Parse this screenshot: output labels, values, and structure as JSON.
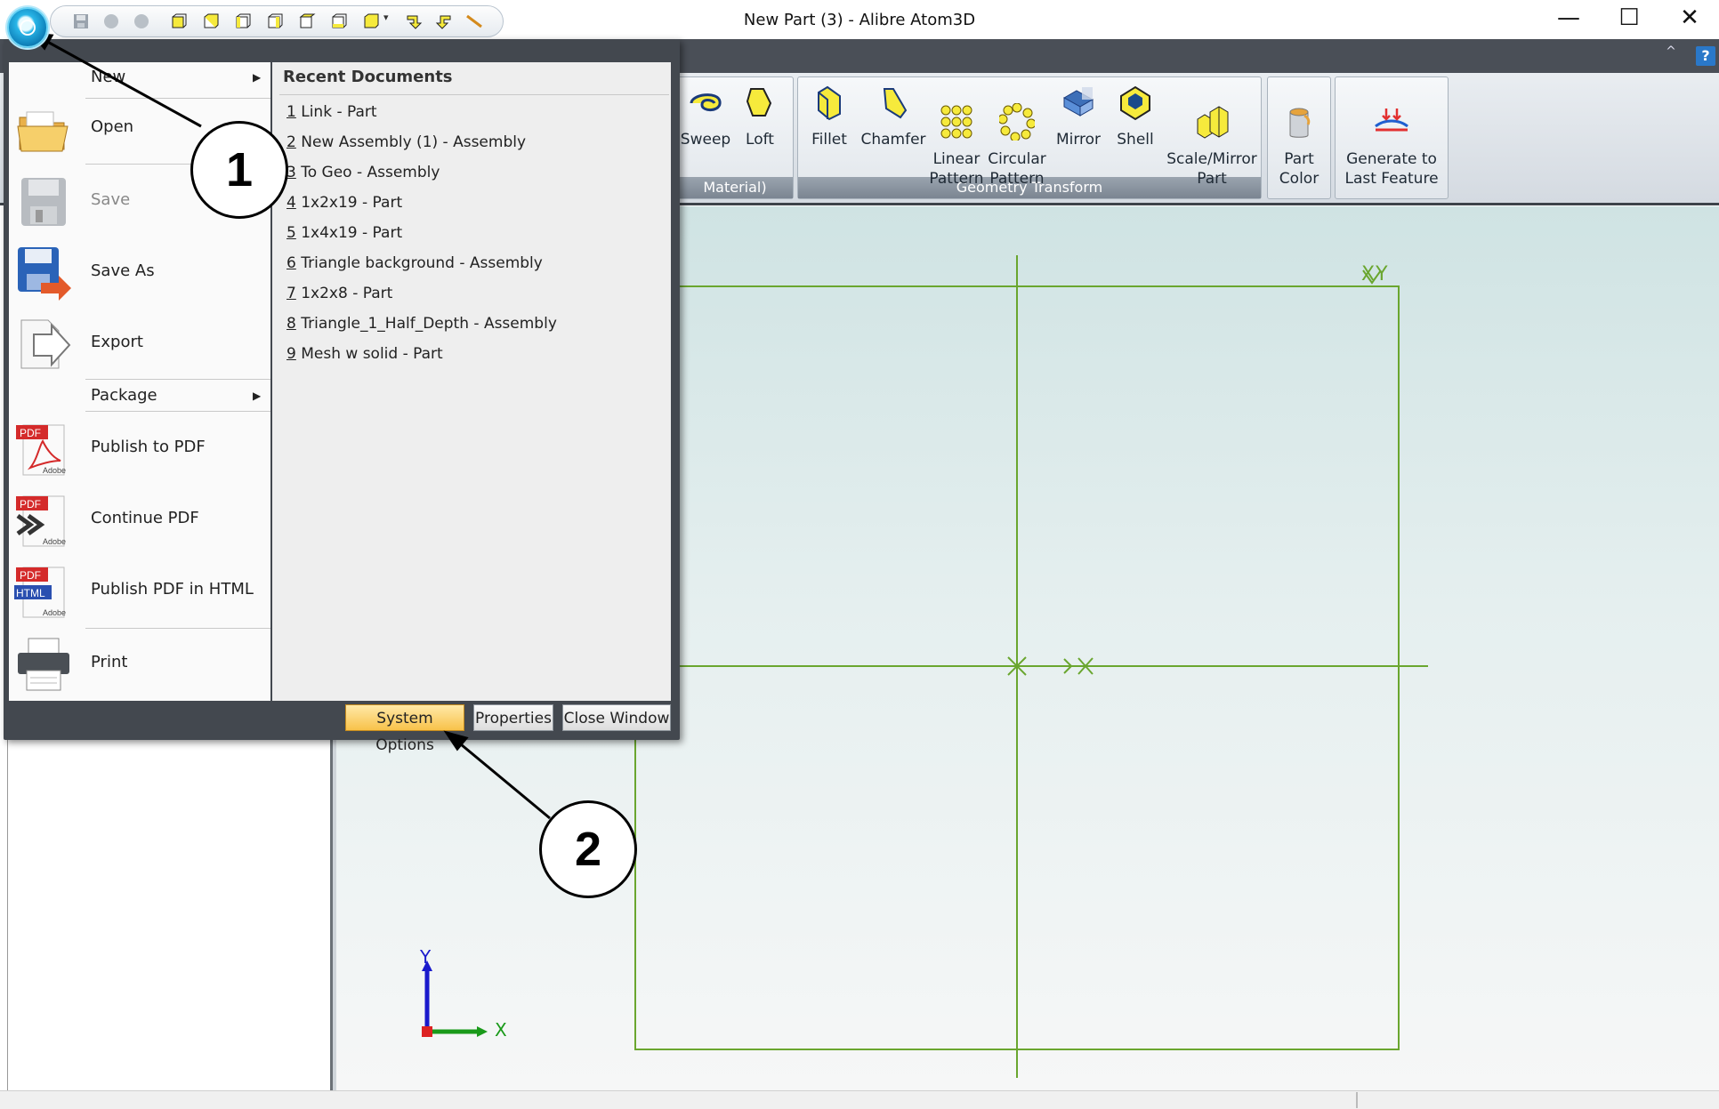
{
  "window": {
    "title": "New Part (3) - Alibre Atom3D",
    "minimize_glyph": "—",
    "maximize_glyph": "☐",
    "close_glyph": "✕"
  },
  "ribbon": {
    "help_label": "?",
    "collapse_glyph": "^",
    "groups": [
      {
        "label": "Material)",
        "buttons": [
          {
            "label": "Sweep"
          },
          {
            "label": "Loft"
          }
        ]
      },
      {
        "label": "Geometry Transform",
        "buttons": [
          {
            "label": "Fillet"
          },
          {
            "label": "Chamfer"
          },
          {
            "label": "Linear\nPattern"
          },
          {
            "label": "Circular\nPattern"
          },
          {
            "label": "Mirror"
          },
          {
            "label": "Shell"
          },
          {
            "label": "Scale/Mirror\nPart"
          }
        ]
      },
      {
        "label": "",
        "buttons": [
          {
            "label": "Part\nColor"
          }
        ]
      },
      {
        "label": "",
        "buttons": [
          {
            "label": "Generate to\nLast Feature"
          }
        ]
      }
    ]
  },
  "app_menu": {
    "items": [
      {
        "label": "New",
        "submenu": true
      },
      {
        "label": "Open"
      },
      {
        "label": "Save",
        "disabled": true
      },
      {
        "label": "Save As"
      },
      {
        "label": "Export"
      },
      {
        "label": "Package",
        "submenu": true
      },
      {
        "label": "Publish to PDF"
      },
      {
        "label": "Continue PDF"
      },
      {
        "label": "Publish PDF in HTML"
      },
      {
        "label": "Print"
      }
    ],
    "recent_heading": "Recent Documents",
    "recent": [
      {
        "num": "1",
        "name": " Link - Part"
      },
      {
        "num": "2",
        "name": " New Assembly (1) - Assembly"
      },
      {
        "num": "3",
        "name": " To Geo - Assembly"
      },
      {
        "num": "4",
        "name": " 1x2x19 - Part"
      },
      {
        "num": "5",
        "name": " 1x4x19 - Part"
      },
      {
        "num": "6",
        "name": " Triangle background - Assembly"
      },
      {
        "num": "7",
        "name": " 1x2x8 - Part"
      },
      {
        "num": "8",
        "name": " Triangle_1_Half_Depth - Assembly"
      },
      {
        "num": "9",
        "name": " Mesh w solid - Part"
      }
    ],
    "buttons": {
      "system_options": "System Options",
      "properties": "Properties",
      "close_window": "Close Window"
    }
  },
  "viewport": {
    "plane_label": "XY",
    "axis_y": "Y",
    "axis_x": "X"
  },
  "annotations": {
    "callout_1": "1",
    "callout_2": "2"
  },
  "colors": {
    "sketch_green": "#6aa62f",
    "highlight": "#f8c24a",
    "orb_blue": "#0e7fb8"
  }
}
